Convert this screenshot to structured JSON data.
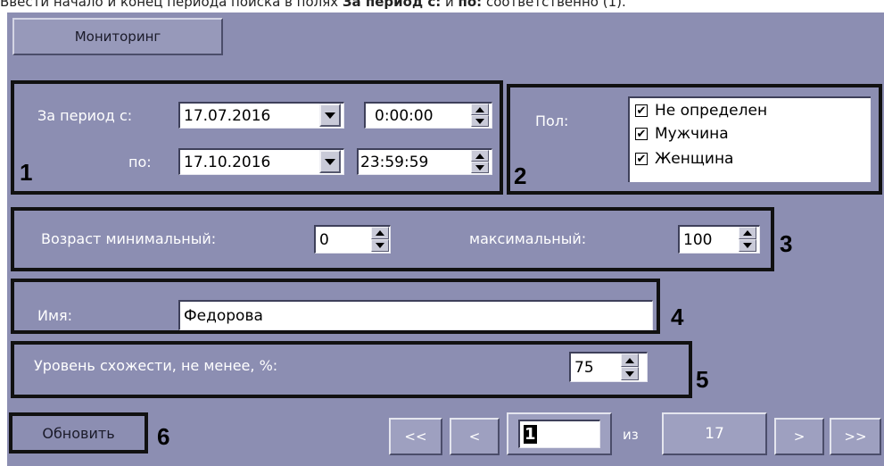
{
  "caption": {
    "prefix": "Ввести начало и конец периода поиска в полях ",
    "bold1": "За период с:",
    "middle": " и ",
    "bold2": "по:",
    "suffix": " соответственно (1)."
  },
  "monitoring_button": "Мониторинг",
  "period": {
    "from_label": "За период с:",
    "to_label": "по:",
    "from_date": "17.07.2016",
    "from_time": "0:00:00",
    "to_date": "17.10.2016",
    "to_time": "23:59:59",
    "marker": "1"
  },
  "gender": {
    "label": "Пол:",
    "options": [
      {
        "label": "Не определен",
        "checked": true
      },
      {
        "label": "Мужчина",
        "checked": true
      },
      {
        "label": "Женщина",
        "checked": true
      }
    ],
    "marker": "2"
  },
  "age": {
    "min_label": "Возраст минимальный:",
    "min_value": "0",
    "max_label": "максимальный:",
    "max_value": "100",
    "marker": "3"
  },
  "name": {
    "label": "Имя:",
    "value": "Федорова",
    "marker": "4"
  },
  "similarity": {
    "label": "Уровень схожести, не менее, %:",
    "value": "75",
    "marker": "5"
  },
  "refresh": {
    "label": "Обновить",
    "marker": "6"
  },
  "pager": {
    "first": "<<",
    "prev": "<",
    "current_page": "1",
    "of_label": "из",
    "total_pages": "17",
    "next": ">",
    "last": ">>"
  },
  "colors": {
    "panel": "#8C8EB2",
    "frame": "#111111",
    "label_text": "#FFFFFF"
  }
}
